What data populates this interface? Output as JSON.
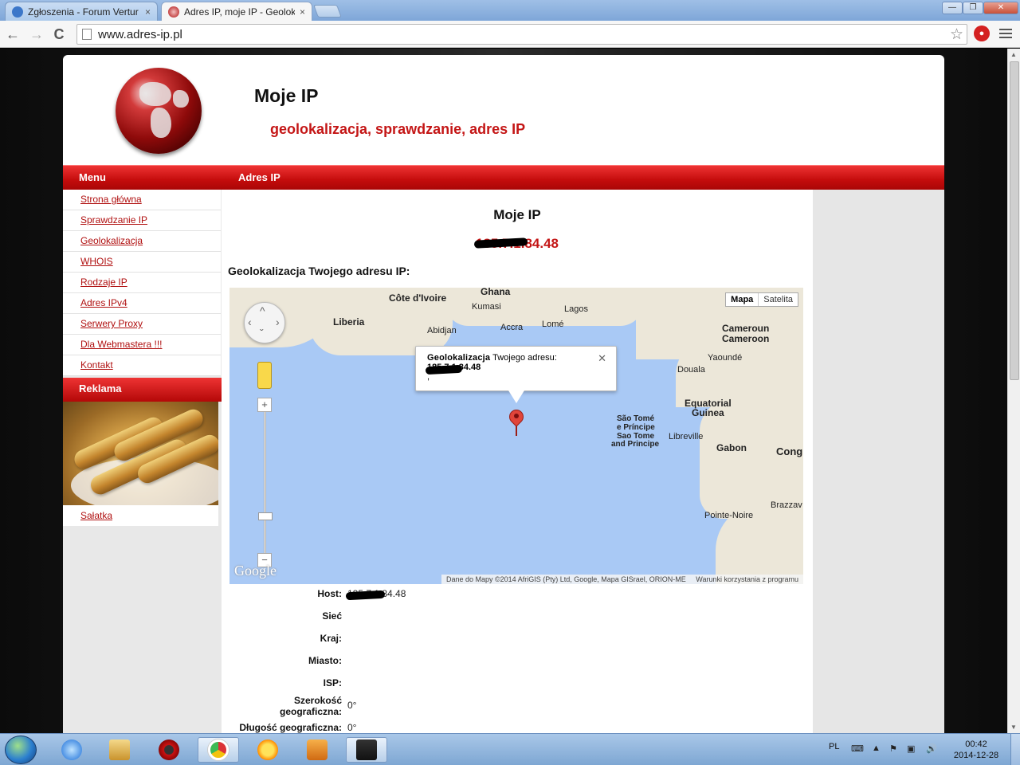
{
  "browser": {
    "tabs": [
      {
        "label": "Zgłoszenia - Forum Vertur",
        "close": "×",
        "active": false
      },
      {
        "label": "Adres IP, moje IP - Geolok",
        "close": "×",
        "active": true
      }
    ],
    "url": "www.adres-ip.pl",
    "icons": [
      "back-icon",
      "forward-icon",
      "reload-icon",
      "star-icon",
      "extension-icon",
      "menu-icon"
    ],
    "back": "←",
    "forward": "→",
    "reload": "C",
    "star": "☆",
    "minimize": "—",
    "maximize": "❐",
    "close": "✕"
  },
  "site": {
    "title": "Moje IP",
    "subtitle": "geolokalizacja, sprawdzanie, adres IP",
    "menu_label": "Menu",
    "section_label": "Adres IP",
    "accent_color": "#c41616"
  },
  "sidebar": {
    "items": [
      {
        "label": "Strona główna"
      },
      {
        "label": "Sprawdzanie IP"
      },
      {
        "label": "Geolokalizacja"
      },
      {
        "label": "WHOIS"
      },
      {
        "label": "Rodzaje IP"
      },
      {
        "label": "Adres IPv4"
      },
      {
        "label": "Serwery Proxy"
      },
      {
        "label": "Dla Webmastera !!!"
      },
      {
        "label": "Kontakt"
      }
    ],
    "reklama_label": "Reklama",
    "ad_caption": "Sałatka"
  },
  "content": {
    "title": "Moje IP",
    "ip_hidden": "185.7.1.",
    "ip_visible": "84.48",
    "geo_heading": "Geolokalizacja Twojego adresu IP:"
  },
  "map": {
    "type_options": [
      "Mapa",
      "Satelita"
    ],
    "selected_type": "Mapa",
    "labels": [
      "Ghana",
      "Côte d'Ivoire",
      "Kumasi",
      "Liberia",
      "Lagos",
      "Accra",
      "Lomé",
      "Abidjan",
      "Cameroun",
      "Cameroon",
      "Yaoundé",
      "Douala",
      "Equatorial",
      "Guinea",
      "São Tomé",
      "e Príncipe",
      "Sao Tome",
      "and Principe",
      "Libreville",
      "Gabon",
      "Cong",
      "Brazzav",
      "Pointe-Noire"
    ],
    "zoom_in": "+",
    "zoom_out": "−",
    "logo": "Google",
    "attribution": "Dane do Mapy ©2014 AfriGIS (Pty) Ltd, Google, Mapa GISrael, ORION-ME",
    "terms": "Warunki korzystania z programu",
    "infowindow": {
      "bold": "Geolokalizacja",
      "text": "Twojego adresu:",
      "ip_hidden": "185.7.1.",
      "ip_visible": "84.48",
      "extra": ",",
      "close": "✕"
    }
  },
  "info": {
    "rows": [
      {
        "key": "Host:",
        "value_hidden": "185.7.1.",
        "value": "84.48"
      },
      {
        "key": "Sieć",
        "value": ""
      },
      {
        "key": "Kraj:",
        "value": ""
      },
      {
        "key": "Miasto:",
        "value": ""
      },
      {
        "key": "ISP:",
        "value": ""
      },
      {
        "key": "Szerokość geograficzna:",
        "value": "0°"
      },
      {
        "key": "Długość geograficzna:",
        "value": "0°"
      }
    ]
  },
  "taskbar": {
    "apps": [
      "windows-start",
      "internet-explorer",
      "file-explorer",
      "recorder",
      "chrome",
      "sun-app",
      "media-player",
      "nero"
    ],
    "language": "PL",
    "time": "00:42",
    "date": "2014-12-28"
  }
}
